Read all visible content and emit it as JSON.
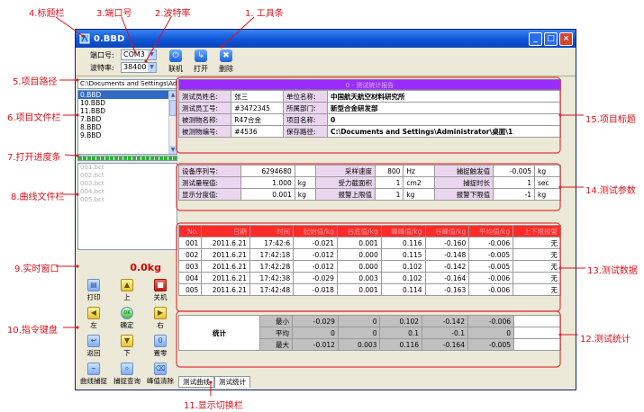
{
  "annotations": {
    "title_bar": "4.标题栏",
    "port_no": "3.端口号",
    "baud_rate": "2.波特率",
    "toolbar": "1. 工具条",
    "project_path": "5.项目路径",
    "project_files": "6.项目文件栏",
    "open_progress": "7.打开进度条",
    "curve_files": "8.曲线文件栏",
    "realtime_window": "9.实时窗口",
    "command_keypad": "10.指令键盘",
    "display_switch": "11.显示切换栏",
    "test_statistics": "12.测试统计",
    "test_data": "13.测试数据",
    "test_params": "14.测试参数",
    "project_title": "15.项目标题"
  },
  "window": {
    "title": "0.BBD"
  },
  "toolbar": {
    "port_label": "端口号:",
    "port_value": "COM3",
    "baud_label": "波特率:",
    "baud_value": "38400",
    "connect_label": "联机",
    "open_label": "打开",
    "delete_label": "删除"
  },
  "sidebar": {
    "path": "C:\\Documents and Settings\\Admi",
    "project_files": [
      "0.BBD",
      "10.BBD",
      "11.BBD",
      "7.BBD",
      "8.BBD",
      "9.BBD"
    ],
    "selected_index": 0,
    "progress": 1.0,
    "curve_files": [
      "001.bct",
      "002.bct",
      "003.bct",
      "004.bct",
      "005.bct"
    ],
    "realtime_value": "0.0kg"
  },
  "keypad": {
    "print": "打印",
    "up": "上",
    "shutdown": "关机",
    "left": "左",
    "confirm": "确定",
    "confirm_icon": "OK",
    "right": "右",
    "back": "返回",
    "down": "下",
    "zero": "置零",
    "curve_capture": "曲线捕捉",
    "capture_query": "捕捉查询",
    "peak_clear": "峰值清除"
  },
  "project": {
    "title": "0 - 测试统计报告",
    "rows": [
      [
        "测试员姓名:",
        "张三",
        "单位名称:",
        "中国航天航空材料研究所"
      ],
      [
        "测试员工号:",
        "#3472345",
        "所属部门:",
        "新型合金研发部"
      ],
      [
        "被测物名称:",
        "R47合金",
        "项目名称:",
        "0"
      ],
      [
        "被测物编号:",
        "#4536",
        "保存路径:",
        "C:\\Documents and Settings\\Administrator\\桌面\\1"
      ]
    ]
  },
  "params": {
    "rows": [
      [
        "设备序列号:",
        "6294680",
        "",
        "采样速度",
        "800",
        "Hz",
        "捕捉触发值",
        "-0.005",
        "kg"
      ],
      [
        "测试量程值:",
        "1.000",
        "kg",
        "受力截面积",
        "1",
        "cm2",
        "捕捉时长",
        "1",
        "sec"
      ],
      [
        "显示分度值:",
        "0.001",
        "kg",
        "报警上限值",
        "1",
        "kg",
        "报警下限值",
        "-1",
        "kg"
      ]
    ]
  },
  "data": {
    "headers": [
      "No.",
      "日期",
      "时间",
      "起始值/kg",
      "谷底值/kg",
      "峰峰值/kg",
      "谷峰值/kg",
      "平均值/kg",
      "上下限报警"
    ],
    "rows": [
      [
        "001",
        "2011.6.21",
        "17:42:6",
        "-0.021",
        "0.001",
        "0.116",
        "-0.160",
        "-0.006",
        "无"
      ],
      [
        "002",
        "2011.6.21",
        "17:42:18",
        "-0.012",
        "0.000",
        "0.115",
        "-0.148",
        "-0.005",
        "无"
      ],
      [
        "003",
        "2011.6.21",
        "17:42:28",
        "-0.012",
        "0.000",
        "0.102",
        "-0.142",
        "-0.005",
        "无"
      ],
      [
        "004",
        "2011.6.21",
        "17:42:38",
        "-0.029",
        "0.003",
        "0.102",
        "-0.164",
        "-0.006",
        "无"
      ],
      [
        "005",
        "2011.6.21",
        "17:42:48",
        "-0.018",
        "0.001",
        "0.114",
        "-0.163",
        "-0.006",
        "无"
      ]
    ]
  },
  "stats": {
    "label": "统计",
    "rows": [
      [
        "最小",
        "-0.029",
        "0",
        "0.102",
        "-0.142",
        "-0.006"
      ],
      [
        "平均",
        "0",
        "0",
        "0.1",
        "-0.1",
        "0"
      ],
      [
        "最大",
        "-0.012",
        "0.003",
        "0.116",
        "-0.164",
        "-0.005"
      ]
    ]
  },
  "tabs": [
    "测试曲线",
    "测试统计"
  ],
  "colors": {
    "annotation": "#d9121a",
    "title_bar": "#0f55d9",
    "project_header": "#9b2aff",
    "data_header": "#ff2a2a",
    "param_label": "#ead7ef"
  }
}
